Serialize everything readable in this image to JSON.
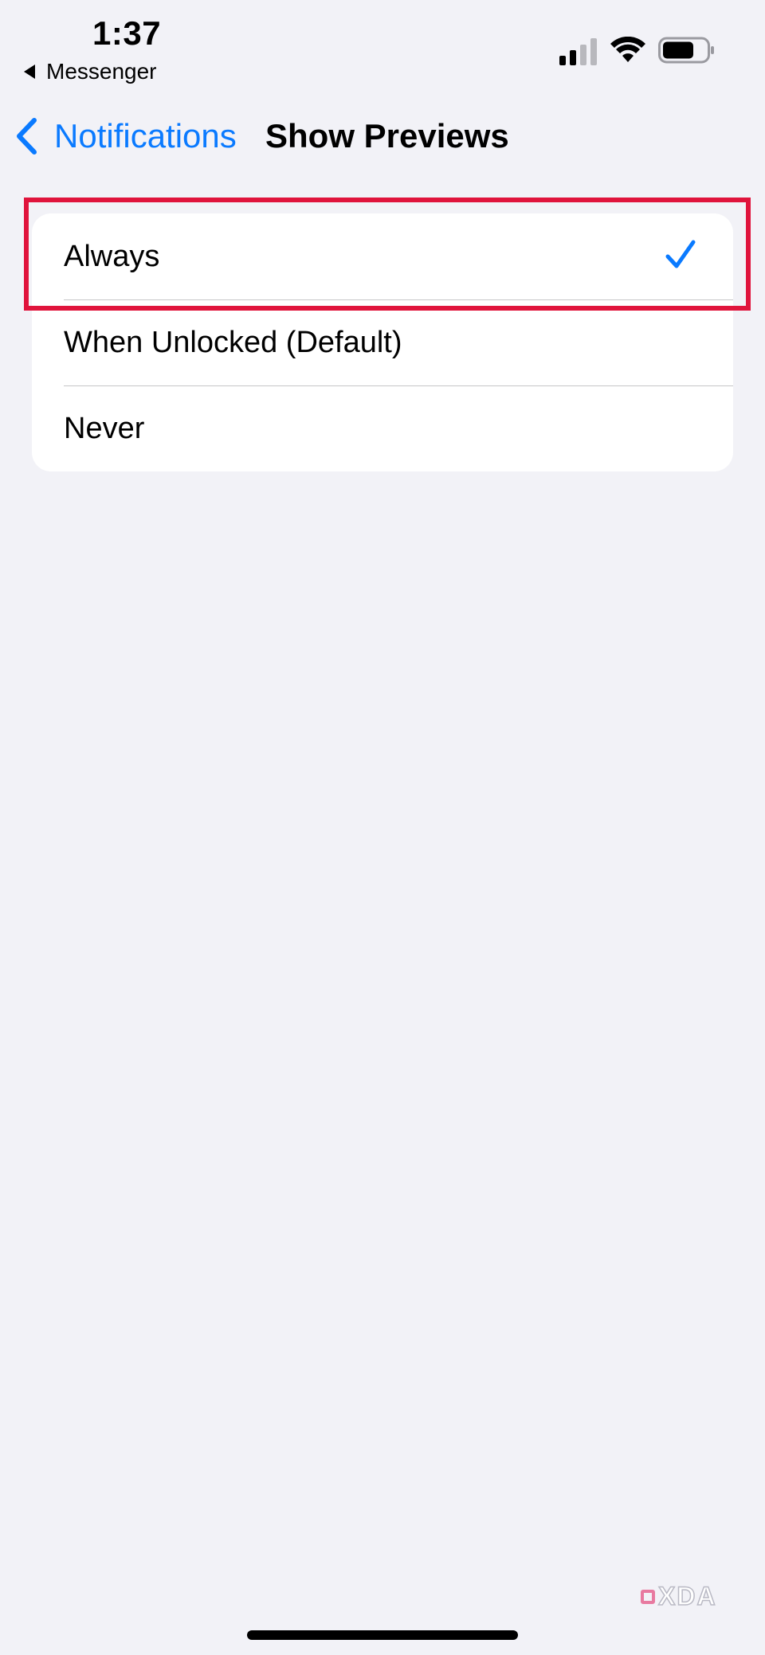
{
  "status_bar": {
    "time": "1:37",
    "back_app_label": "Messenger",
    "signal_icon": "cellular-signal-icon",
    "wifi_icon": "wifi-icon",
    "battery_icon": "battery-icon"
  },
  "nav": {
    "back_label": "Notifications",
    "back_icon": "chevron-left-icon",
    "title": "Show Previews"
  },
  "options": [
    {
      "label": "Always",
      "selected": true
    },
    {
      "label": "When Unlocked (Default)",
      "selected": false
    },
    {
      "label": "Never",
      "selected": false
    }
  ],
  "watermark": {
    "text": "XDA"
  },
  "colors": {
    "accent": "#0a7aff",
    "highlight": "#e0143c",
    "background": "#f2f2f7",
    "card": "#ffffff"
  }
}
